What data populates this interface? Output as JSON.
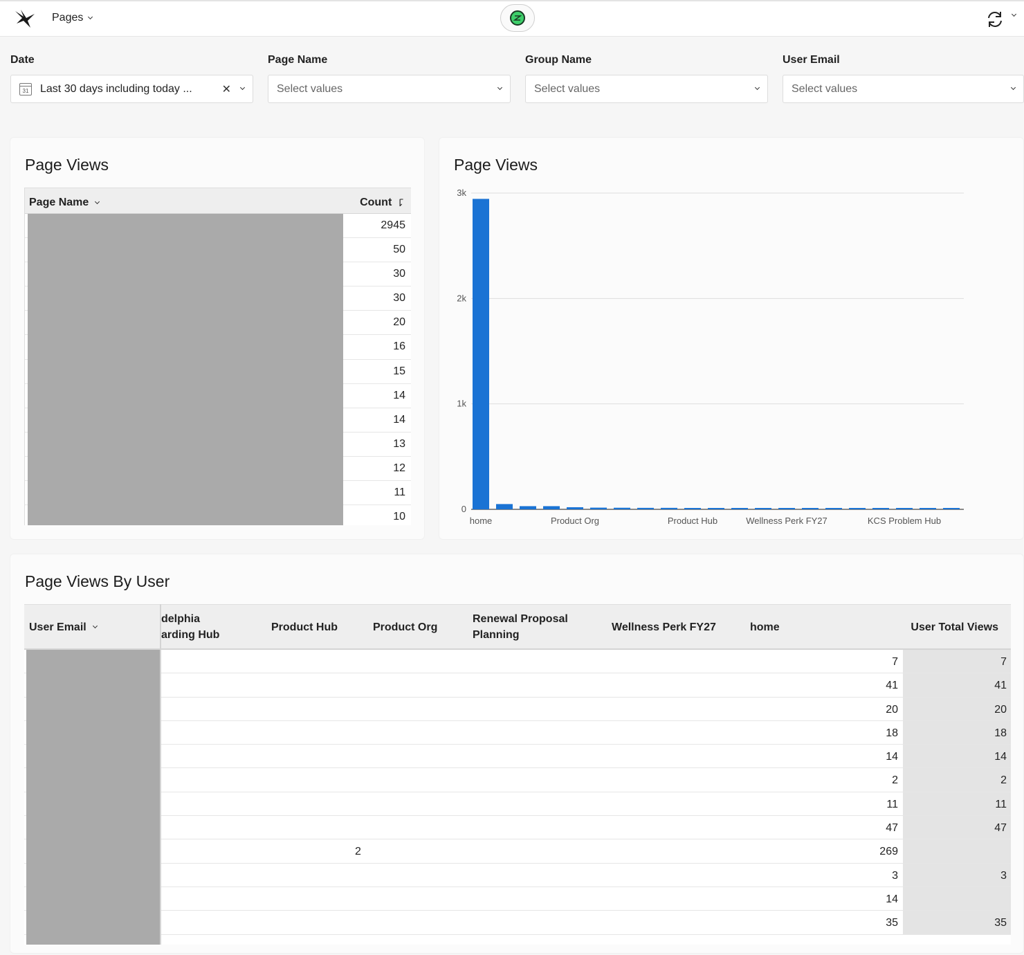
{
  "topbar": {
    "menu_label": "Pages",
    "logo_icon": "bird-logo-icon",
    "center_icon": "gem-icon",
    "refresh_icon": "refresh-icon"
  },
  "filters": [
    {
      "label": "Date",
      "value": "Last 30 days including today ...",
      "placeholder": ""
    },
    {
      "label": "Page Name",
      "value": "",
      "placeholder": "Select values"
    },
    {
      "label": "Group Name",
      "value": "",
      "placeholder": "Select values"
    },
    {
      "label": "User Email",
      "value": "",
      "placeholder": "Select values"
    }
  ],
  "page_views_table": {
    "title": "Page Views",
    "col_page_name": "Page Name",
    "col_count": "Count",
    "counts": [
      "2945",
      "50",
      "30",
      "30",
      "20",
      "16",
      "15",
      "14",
      "14",
      "13",
      "12",
      "11",
      "10"
    ]
  },
  "page_views_chart": {
    "title": "Page Views"
  },
  "chart_data": {
    "type": "bar",
    "title": "Page Views",
    "xlabel": "",
    "ylabel": "",
    "ylim": [
      0,
      3000
    ],
    "y_ticks": [
      "0",
      "1k",
      "2k",
      "3k"
    ],
    "x_tick_labels": [
      {
        "index": 0,
        "label": "home"
      },
      {
        "index": 4,
        "label": "Product Org"
      },
      {
        "index": 9,
        "label": "Product Hub"
      },
      {
        "index": 13,
        "label": "Wellness Perk FY27"
      },
      {
        "index": 18,
        "label": "KCS Problem Hub"
      }
    ],
    "values": [
      2945,
      50,
      30,
      30,
      20,
      16,
      15,
      14,
      14,
      13,
      12,
      11,
      10,
      9,
      8,
      8,
      7,
      7,
      6,
      6,
      5
    ],
    "grid": true,
    "color": "#1a73d4"
  },
  "by_user_table": {
    "title": "Page Views By User",
    "col_user_email": "User Email",
    "columns": [
      "delphia\narding Hub",
      "Product Hub",
      "Product Org",
      "Renewal Proposal\nPlanning",
      "Wellness Perk FY27",
      "home",
      "User Total Views"
    ],
    "rows": [
      {
        "product": "",
        "home": "7",
        "total": "7"
      },
      {
        "product": "",
        "home": "41",
        "total": "41"
      },
      {
        "product": "",
        "home": "20",
        "total": "20"
      },
      {
        "product": "",
        "home": "18",
        "total": "18"
      },
      {
        "product": "",
        "home": "14",
        "total": "14"
      },
      {
        "product": "",
        "home": "2",
        "total": "2"
      },
      {
        "product": "",
        "home": "11",
        "total": "11"
      },
      {
        "product": "",
        "home": "47",
        "total": "47"
      },
      {
        "product": "2",
        "home": "269",
        "total": ""
      },
      {
        "product": "",
        "home": "3",
        "total": "3"
      },
      {
        "product": "",
        "home": "14",
        "total": ""
      },
      {
        "product": "",
        "home": "35",
        "total": "35"
      }
    ]
  }
}
